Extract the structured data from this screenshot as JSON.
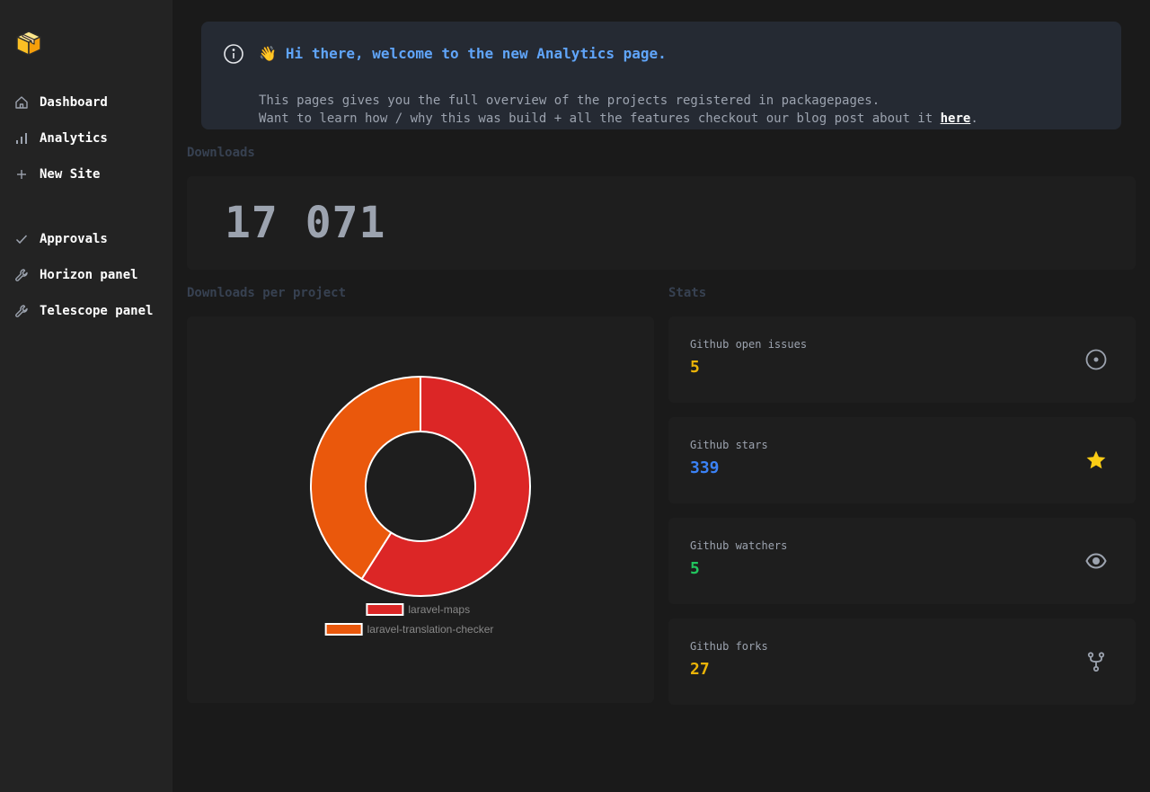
{
  "sidebar": {
    "logo_icon": "package-box-icon",
    "items": [
      {
        "label": "Dashboard",
        "icon": "home-icon"
      },
      {
        "label": "Analytics",
        "icon": "bar-chart-icon"
      },
      {
        "label": "New Site",
        "icon": "plus-icon"
      },
      {
        "label": "Approvals",
        "icon": "check-icon"
      },
      {
        "label": "Horizon panel",
        "icon": "wrench-icon"
      },
      {
        "label": "Telescope panel",
        "icon": "wrench-icon"
      }
    ]
  },
  "banner": {
    "emoji": "👋",
    "title": "Hi there, welcome to the new Analytics page.",
    "line1": "This pages gives you the full overview of the projects registered in packagepages.",
    "line2_prefix": "Want to learn how / why this was build + all the features checkout our blog post about it ",
    "link_text": "here",
    "line2_suffix": "."
  },
  "downloads": {
    "label": "Downloads",
    "value": "17 071"
  },
  "downloads_per_project": {
    "label": "Downloads per project"
  },
  "chart_data": {
    "type": "pie",
    "variant": "doughnut",
    "categories": [
      "laravel-maps",
      "laravel-translation-checker"
    ],
    "values": [
      59,
      41
    ],
    "colors": [
      "#dc2626",
      "#ea580c"
    ],
    "legend": "bottom"
  },
  "stats": {
    "label": "Stats",
    "items": [
      {
        "label": "Github open issues",
        "value": "5",
        "color": "#eab308",
        "icon": "circle-dot-icon"
      },
      {
        "label": "Github stars",
        "value": "339",
        "color": "#3b82f6",
        "icon": "star-icon"
      },
      {
        "label": "Github watchers",
        "value": "5",
        "color": "#22c55e",
        "icon": "eye-icon"
      },
      {
        "label": "Github forks",
        "value": "27",
        "color": "#eab308",
        "icon": "fork-icon"
      }
    ]
  },
  "colors": {
    "accent": "#60a5fa",
    "background": "#1a1a1a",
    "sidebar": "#232323",
    "star": "#facc15"
  }
}
